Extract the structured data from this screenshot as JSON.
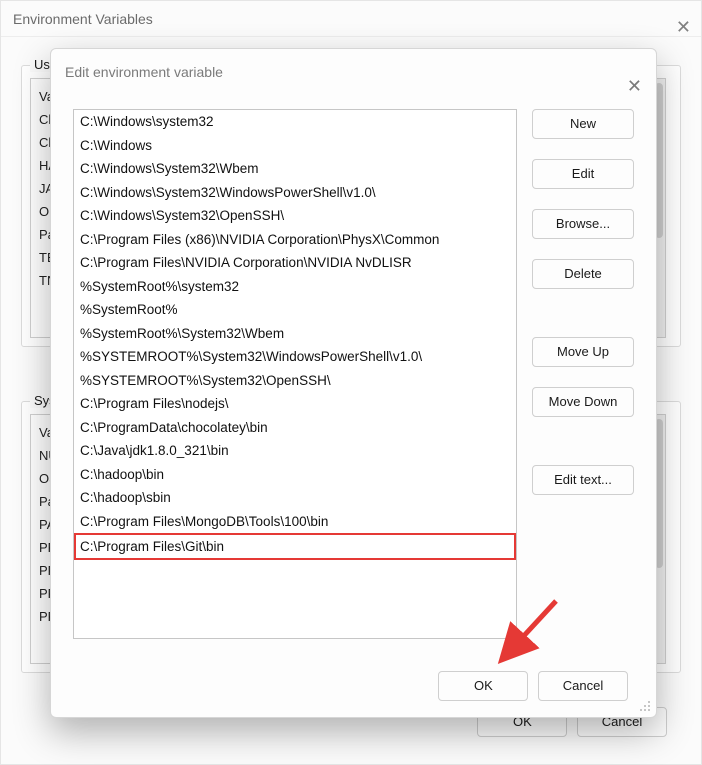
{
  "bg": {
    "title": "Environment Variables",
    "user_label": "User",
    "sys_label": "Syste",
    "user_rows": [
      "Va",
      "Ch",
      "Ch",
      "HA",
      "JA",
      "On",
      "Pa",
      "TE",
      "TN"
    ],
    "sys_rows": [
      "Va",
      "NU",
      "OS",
      "Pa",
      "PA",
      "PR",
      "PR",
      "PR",
      "PP"
    ],
    "ok": "OK",
    "cancel": "Cancel"
  },
  "fg": {
    "title": "Edit environment variable",
    "paths": [
      "C:\\Windows\\system32",
      "C:\\Windows",
      "C:\\Windows\\System32\\Wbem",
      "C:\\Windows\\System32\\WindowsPowerShell\\v1.0\\",
      "C:\\Windows\\System32\\OpenSSH\\",
      "C:\\Program Files (x86)\\NVIDIA Corporation\\PhysX\\Common",
      "C:\\Program Files\\NVIDIA Corporation\\NVIDIA NvDLISR",
      "%SystemRoot%\\system32",
      "%SystemRoot%",
      "%SystemRoot%\\System32\\Wbem",
      "%SYSTEMROOT%\\System32\\WindowsPowerShell\\v1.0\\",
      "%SYSTEMROOT%\\System32\\OpenSSH\\",
      "C:\\Program Files\\nodejs\\",
      "C:\\ProgramData\\chocolatey\\bin",
      "C:\\Java\\jdk1.8.0_321\\bin",
      "C:\\hadoop\\bin",
      "C:\\hadoop\\sbin",
      "C:\\Program Files\\MongoDB\\Tools\\100\\bin",
      "C:\\Program Files\\Git\\bin"
    ],
    "highlight_index": 18,
    "buttons": {
      "new": "New",
      "edit": "Edit",
      "browse": "Browse...",
      "delete": "Delete",
      "move_up": "Move Up",
      "move_down": "Move Down",
      "edit_text": "Edit text..."
    },
    "ok": "OK",
    "cancel": "Cancel"
  },
  "annotation": {
    "arrow_color": "#e53935"
  }
}
